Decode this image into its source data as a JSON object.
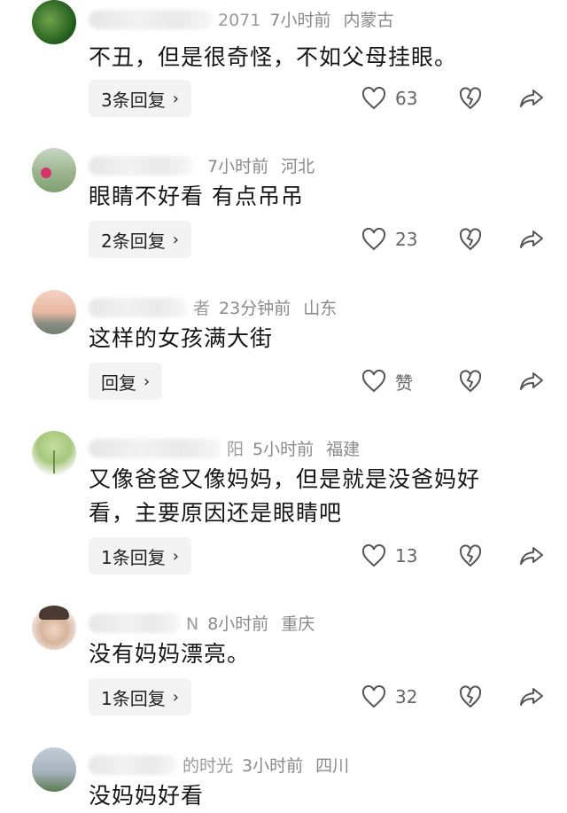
{
  "comments": [
    {
      "name_tail": "2071",
      "time": "7小时前",
      "location": "内蒙古",
      "text": [
        "不丑，但是很奇怪，不如父母挂眼。"
      ],
      "reply_label": "3条回复",
      "likes": "63",
      "avatar_colors": [
        "#1f5a1a",
        "#6fa34c"
      ]
    },
    {
      "name_tail": "",
      "time": "7小时前",
      "location": "河北",
      "text": [
        "眼睛不好看 有点吊吊"
      ],
      "reply_label": "2条回复",
      "likes": "23",
      "avatar_colors": [
        "#7fa071",
        "#c9d7c6"
      ]
    },
    {
      "name_tail": "者",
      "time": "23分钟前",
      "location": "山东",
      "text": [
        "这样的女孩满大街"
      ],
      "reply_label": "回复",
      "likes": "赞",
      "avatar_colors": [
        "#e9b9a4",
        "#6b7f6e"
      ]
    },
    {
      "name_tail": "阳",
      "time": "5小时前",
      "location": "福建",
      "text": [
        "又像爸爸又像妈妈，但是就是没爸妈好",
        "看，主要原因还是眼睛吧"
      ],
      "reply_label": "1条回复",
      "likes": "13",
      "avatar_colors": [
        "#dfe9d0",
        "#a6c77d"
      ]
    },
    {
      "name_tail": "N",
      "time": "8小时前",
      "location": "重庆",
      "text": [
        "没有妈妈漂亮。"
      ],
      "reply_label": "1条回复",
      "likes": "32",
      "avatar_colors": [
        "#d7b49c",
        "#f3ece7"
      ]
    },
    {
      "name_tail": "的时光",
      "time": "3小时前",
      "location": "四川",
      "text": [
        "没妈妈好看"
      ],
      "reply_label": "",
      "likes": "",
      "avatar_colors": [
        "#a7b3bf",
        "#5d7a52"
      ]
    }
  ],
  "colors": {
    "text": "#161616",
    "meta": "#8a8a8a",
    "reply_bg": "#f3f3f3",
    "icon": "#555555"
  },
  "icons": {
    "like": "heart-outline-icon",
    "dislike": "broken-heart-icon",
    "share": "share-arrow-icon"
  }
}
